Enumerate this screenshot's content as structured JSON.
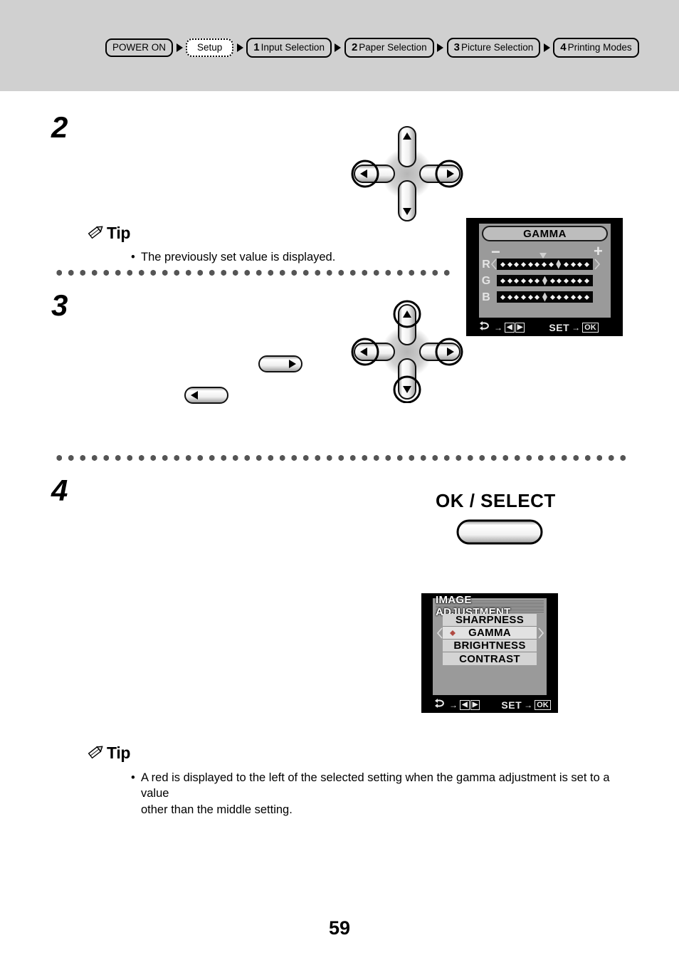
{
  "header": {
    "breadcrumb": [
      {
        "num": "",
        "label": "POWER ON",
        "style": "solid"
      },
      {
        "num": "",
        "label": "Setup",
        "style": "dotted"
      },
      {
        "num": "1",
        "label": "Input Selection",
        "style": "solid"
      },
      {
        "num": "2",
        "label": "Paper Selection",
        "style": "solid"
      },
      {
        "num": "3",
        "label": "Picture Selection",
        "style": "solid"
      },
      {
        "num": "4",
        "label": "Printing Modes",
        "style": "solid"
      }
    ]
  },
  "steps": {
    "two": "2",
    "three": "3",
    "four": "4"
  },
  "tips": {
    "first": {
      "label": "Tip",
      "bullet": "•",
      "text": "The previously set value is displayed."
    },
    "second": {
      "label": "Tip",
      "bullet": "•",
      "line1": "A red      is displayed to the left of the selected setting when the gamma adjustment is set to a value",
      "line2": "other than the middle setting."
    }
  },
  "controls": {
    "ok_select_label": "OK / SELECT"
  },
  "gamma_screen": {
    "title": "GAMMA",
    "minus": "−",
    "plus": "+",
    "rows": [
      {
        "label": "R",
        "positions": 13,
        "marker_index": 8
      },
      {
        "label": "G",
        "positions": 13,
        "marker_index": 6
      },
      {
        "label": "B",
        "positions": 13,
        "marker_index": 6
      }
    ],
    "footer": {
      "cycle_icon": "cycle-arrow-icon",
      "arrow_to": "→",
      "left_key": "◀",
      "right_key": "▶",
      "set_label": "SET",
      "ok_key": "OK"
    }
  },
  "image_adjustment_screen": {
    "title": "IMAGE ADJUSTMENT",
    "items": [
      {
        "label": "SHARPNESS",
        "selected": false
      },
      {
        "label": "GAMMA",
        "selected": true
      },
      {
        "label": "BRIGHTNESS",
        "selected": false
      },
      {
        "label": "CONTRAST",
        "selected": false
      }
    ],
    "marker_color": "#b04a42",
    "footer": {
      "cycle_icon": "cycle-arrow-icon",
      "arrow_to": "→",
      "left_key": "◀",
      "right_key": "▶",
      "set_label": "SET",
      "ok_key": "OK"
    }
  },
  "footer": {
    "page_number": "59"
  }
}
